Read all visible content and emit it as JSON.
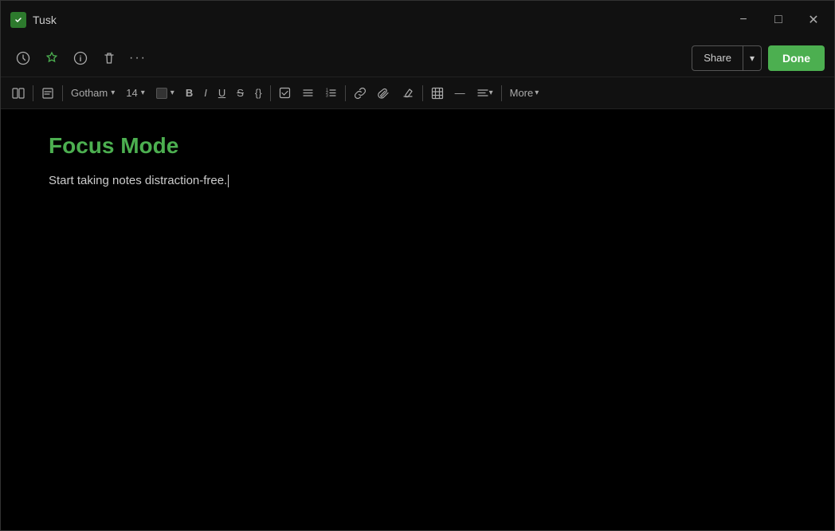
{
  "titleBar": {
    "appName": "Tusk",
    "minimizeTitle": "Minimize",
    "maximizeTitle": "Maximize",
    "closeTitle": "Close"
  },
  "toolbar": {
    "reminder": "reminder",
    "star": "star",
    "info": "info",
    "delete": "delete",
    "more": "more",
    "shareLabel": "Share",
    "doneLabel": "Done"
  },
  "formatBar": {
    "viewMode": "view-mode",
    "font": "Gotham",
    "fontSize": "14",
    "colorLabel": "color",
    "boldLabel": "B",
    "italicLabel": "I",
    "underlineLabel": "U",
    "strikeLabel": "S",
    "codeLabel": "{}",
    "checkboxLabel": "✓",
    "listLabel": "≡",
    "numberedListLabel": "≡",
    "linkLabel": "link",
    "attachLabel": "attach",
    "highlightLabel": "highlight",
    "tableLabel": "table",
    "dividerLabel": "—",
    "alignLabel": "align",
    "moreLabel": "More"
  },
  "editor": {
    "title": "Focus Mode",
    "body": "Start taking notes distraction-free."
  }
}
